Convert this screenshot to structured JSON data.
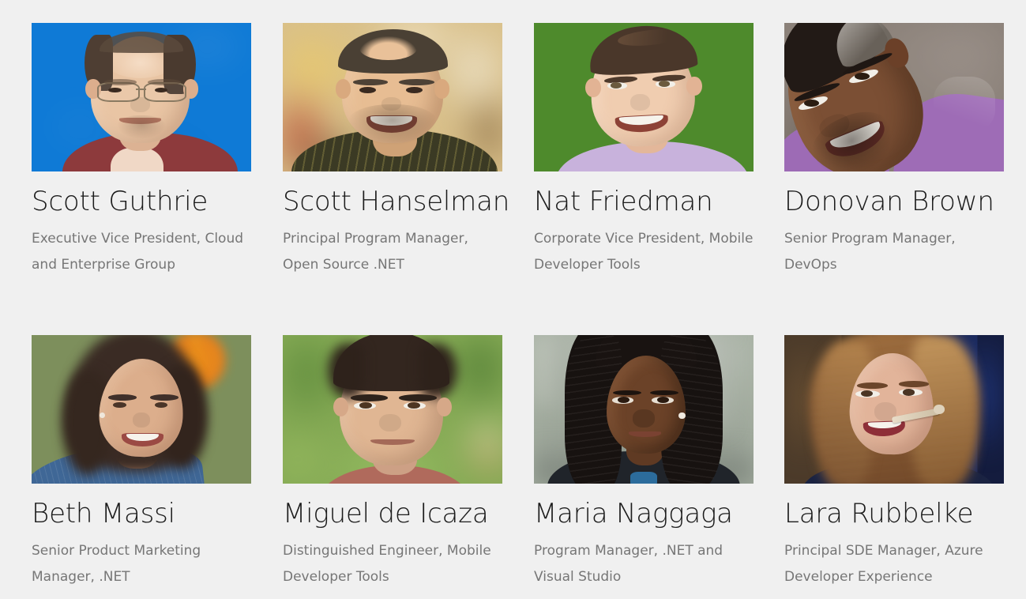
{
  "page": {
    "background_color": "#f0f0f0",
    "name_color": "#1b1b1b",
    "title_color": "#767676",
    "columns": 4,
    "rows": 2
  },
  "people": [
    {
      "name": "Scott Guthrie",
      "title": "Executive Vice President, Cloud and Enterprise Group",
      "photo_alt": "portrait-scott-guthrie",
      "photo_colors": {
        "background": "#0f7ad6",
        "skin": "#e8c3a6",
        "hair": "#4a3a2f",
        "garment": "#8d3a3c"
      }
    },
    {
      "name": "Scott Hanselman",
      "title": "Principal Program Manager, Open Source .NET",
      "photo_alt": "portrait-scott-hanselman",
      "photo_colors": {
        "background": "#c8a martyr",
        "skin": "#e6bd95",
        "hair": "#4b4033",
        "garment": "#3c3a25"
      }
    },
    {
      "name": "Nat Friedman",
      "title": "Corporate Vice President, Mobile Developer Tools",
      "photo_alt": "portrait-nat-friedman",
      "photo_colors": {
        "background": "#4f8b2a",
        "skin": "#f0cdb0",
        "hair": "#4a372a",
        "garment": "#c9b3db"
      }
    },
    {
      "name": "Donovan Brown",
      "title": "Senior Program Manager, DevOps",
      "photo_alt": "portrait-donovan-brown",
      "photo_colors": {
        "background": "#8b8179",
        "skin": "#7a4e33",
        "hair": "#2a211c",
        "garment": "#9d6bb5"
      }
    },
    {
      "name": "Beth Massi",
      "title": "Senior Product Marketing Manager, .NET",
      "photo_alt": "portrait-beth-massi",
      "photo_colors": {
        "background": "#6d8a4a",
        "skin": "#dcae8c",
        "hair": "#3a2b24",
        "garment": "#3f6796"
      }
    },
    {
      "name": "Miguel de Icaza",
      "title": "Distinguished Engineer, Mobile Developer Tools",
      "photo_alt": "portrait-miguel-de-icaza",
      "photo_colors": {
        "background": "#7da54e",
        "skin": "#e0b693",
        "hair": "#33261f",
        "garment": "#b06a5c"
      }
    },
    {
      "name": "Maria Naggaga",
      "title": "Program Manager, .NET and Visual Studio",
      "photo_alt": "portrait-maria-naggaga",
      "photo_colors": {
        "background": "#9fae9b",
        "skin": "#6b4228",
        "hair": "#191311",
        "garment": "#20242a"
      }
    },
    {
      "name": "Lara Rubbelke",
      "title": "Principal SDE Manager, Azure Developer Experience",
      "photo_alt": "portrait-lara-rubbelke",
      "photo_colors": {
        "background": "#2b2238",
        "skin": "#e2b49a",
        "hair": "#8d5c34",
        "garment": "#1a2a52"
      }
    }
  ]
}
